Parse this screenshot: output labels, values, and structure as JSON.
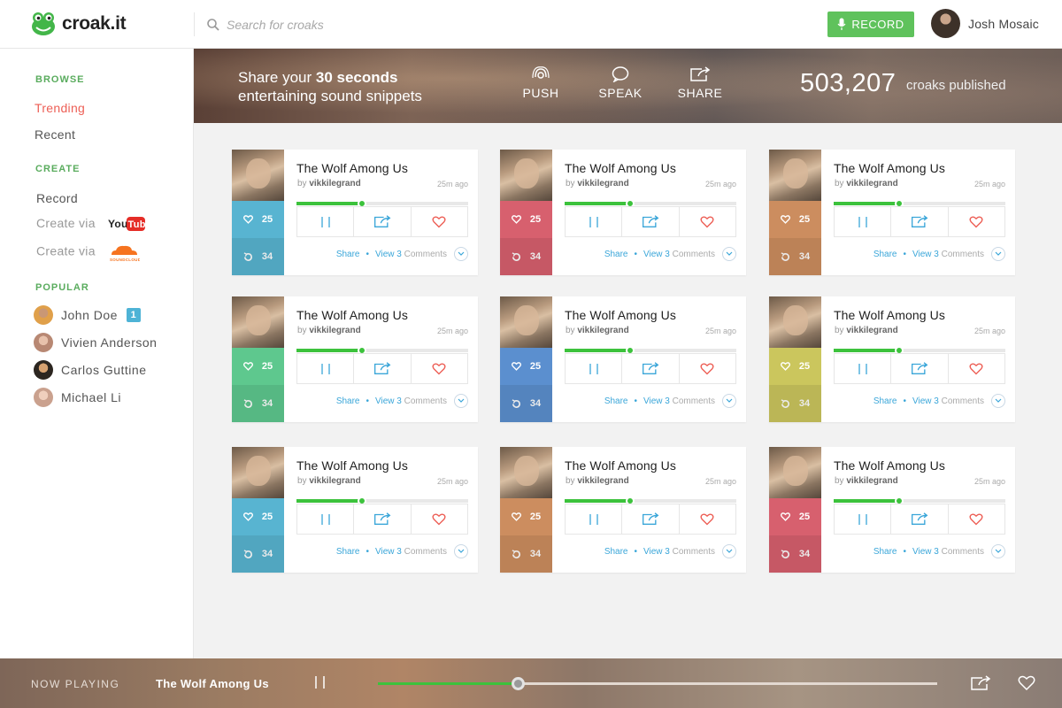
{
  "app": {
    "name": "croak.it"
  },
  "header": {
    "search_placeholder": "Search for croaks",
    "record_label": "RECORD",
    "user_name": "Josh Mosaic"
  },
  "sidebar": {
    "browse_title": "BROWSE",
    "browse": [
      {
        "label": "Trending",
        "active": true
      },
      {
        "label": "Recent",
        "active": false
      }
    ],
    "create_title": "CREATE",
    "create_record": "Record",
    "create_via_youtube": "Create via",
    "youtube_logo": "YouTube",
    "create_via_soundcloud": "Create via",
    "soundcloud_logo": "SOUNDCLOUD",
    "popular_title": "POPULAR",
    "popular": [
      {
        "name": "John Doe",
        "badge": "1"
      },
      {
        "name": "Vivien Anderson"
      },
      {
        "name": "Carlos Guttine"
      },
      {
        "name": "Michael Li"
      }
    ]
  },
  "banner": {
    "line1_prefix": "Share your ",
    "line1_bold": "30 seconds",
    "line2": "entertaining sound snippets",
    "actions": [
      {
        "label": "PUSH",
        "icon": "push-icon"
      },
      {
        "label": "SPEAK",
        "icon": "speech-bubble-icon"
      },
      {
        "label": "SHARE",
        "icon": "share-icon"
      }
    ],
    "count": "503,207",
    "count_label": "croaks published"
  },
  "cards": [
    {
      "title": "The Wolf Among Us",
      "by": "by",
      "author": "vikkilegrand",
      "time": "25m ago",
      "likes": "25",
      "reposts": "34",
      "color": "#58b4d1",
      "progress": 0.38,
      "share": "Share",
      "view": "View",
      "comments_count": "3",
      "comments": "Comments"
    },
    {
      "title": "The Wolf Among Us",
      "by": "by",
      "author": "vikkilegrand",
      "time": "25m ago",
      "likes": "25",
      "reposts": "34",
      "color": "#d7606e",
      "progress": 0.38,
      "share": "Share",
      "view": "View",
      "comments_count": "3",
      "comments": "Comments"
    },
    {
      "title": "The Wolf Among Us",
      "by": "by",
      "author": "vikkilegrand",
      "time": "25m ago",
      "likes": "25",
      "reposts": "34",
      "color": "#cc8d5f",
      "progress": 0.38,
      "share": "Share",
      "view": "View",
      "comments_count": "3",
      "comments": "Comments"
    },
    {
      "title": "The Wolf Among Us",
      "by": "by",
      "author": "vikkilegrand",
      "time": "25m ago",
      "likes": "25",
      "reposts": "34",
      "color": "#5ec88e",
      "progress": 0.38,
      "share": "Share",
      "view": "View",
      "comments_count": "3",
      "comments": "Comments"
    },
    {
      "title": "The Wolf Among Us",
      "by": "by",
      "author": "vikkilegrand",
      "time": "25m ago",
      "likes": "25",
      "reposts": "34",
      "color": "#5b8fcf",
      "progress": 0.38,
      "share": "Share",
      "view": "View",
      "comments_count": "3",
      "comments": "Comments"
    },
    {
      "title": "The Wolf Among Us",
      "by": "by",
      "author": "vikkilegrand",
      "time": "25m ago",
      "likes": "25",
      "reposts": "34",
      "color": "#cbc65d",
      "progress": 0.38,
      "share": "Share",
      "view": "View",
      "comments_count": "3",
      "comments": "Comments"
    },
    {
      "title": "The Wolf Among Us",
      "by": "by",
      "author": "vikkilegrand",
      "time": "25m ago",
      "likes": "25",
      "reposts": "34",
      "color": "#58b4d1",
      "progress": 0.38,
      "share": "Share",
      "view": "View",
      "comments_count": "3",
      "comments": "Comments"
    },
    {
      "title": "The Wolf Among Us",
      "by": "by",
      "author": "vikkilegrand",
      "time": "25m ago",
      "likes": "25",
      "reposts": "34",
      "color": "#cc8d5f",
      "progress": 0.38,
      "share": "Share",
      "view": "View",
      "comments_count": "3",
      "comments": "Comments"
    },
    {
      "title": "The Wolf Among Us",
      "by": "by",
      "author": "vikkilegrand",
      "time": "25m ago",
      "likes": "25",
      "reposts": "34",
      "color": "#d7606e",
      "progress": 0.38,
      "share": "Share",
      "view": "View",
      "comments_count": "3",
      "comments": "Comments"
    }
  ],
  "player": {
    "label": "NOW PLAYING",
    "title": "The Wolf Among Us",
    "progress": 0.25
  },
  "colors": {
    "accent_green": "#5fc25c",
    "active_red": "#ed5f56",
    "link_blue": "#3aa6d9"
  }
}
